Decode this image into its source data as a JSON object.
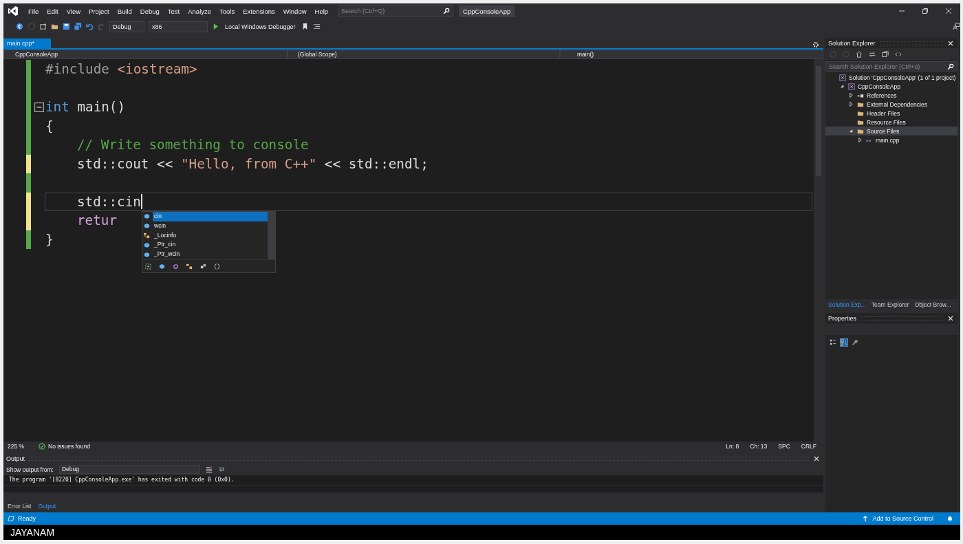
{
  "menu": [
    "File",
    "Edit",
    "View",
    "Project",
    "Build",
    "Debug",
    "Test",
    "Analyze",
    "Tools",
    "Extensions",
    "Window",
    "Help"
  ],
  "search": {
    "placeholder": "Search (Ctrl+Q)"
  },
  "window": {
    "title": "CppConsoleApp"
  },
  "toolbar": {
    "configuration": "Debug",
    "platform": "x86",
    "debugger": "Local Windows Debugger"
  },
  "editor": {
    "tabs": [
      {
        "label": "main.cpp*",
        "selected": true
      }
    ],
    "nav": {
      "project": "CppConsoleApp",
      "scope": "(Global Scope)",
      "member": "main()"
    },
    "lines": [
      {
        "modified": false,
        "fold": false,
        "current": false,
        "indented": false,
        "tokens": [
          {
            "kind": "preproc",
            "text": "#include "
          },
          {
            "kind": "string",
            "text": "<iostream>"
          }
        ]
      },
      {
        "modified": false,
        "fold": false,
        "current": false
      },
      {
        "modified": false,
        "fold": true,
        "current": false,
        "indented": false,
        "tokens": [
          {
            "kind": "keyword",
            "text": "int"
          },
          {
            "kind": "plain",
            "text": " main()"
          }
        ]
      },
      {
        "modified": false,
        "fold": false,
        "current": false,
        "indented": false,
        "tokens": [
          {
            "kind": "plain",
            "text": "{"
          }
        ]
      },
      {
        "modified": false,
        "fold": false,
        "current": false,
        "indented": true,
        "tokens": [
          {
            "kind": "comment",
            "text": "// Write something to console"
          }
        ]
      },
      {
        "modified": true,
        "fold": false,
        "current": false,
        "indented": true,
        "tokens": [
          {
            "kind": "plain",
            "text": "std::cout << "
          },
          {
            "kind": "string",
            "text": "\"Hello, from C++\""
          },
          {
            "kind": "plain",
            "text": " << std::endl;"
          }
        ]
      },
      {
        "modified": false,
        "fold": false,
        "current": false
      },
      {
        "modified": true,
        "fold": false,
        "current": true,
        "indented": true,
        "tokens": [
          {
            "kind": "plain",
            "text": "std::cin"
          }
        ]
      },
      {
        "modified": true,
        "fold": false,
        "current": false,
        "indented": true,
        "tokens": [
          {
            "kind": "control",
            "text": "retur"
          }
        ]
      },
      {
        "modified": false,
        "fold": false,
        "current": false,
        "indented": false,
        "tokens": [
          {
            "kind": "plain",
            "text": "}"
          }
        ]
      }
    ],
    "completion": {
      "items": [
        {
          "label": "cin",
          "kind": "variable",
          "selected": true
        },
        {
          "label": "wcin",
          "kind": "variable",
          "selected": false
        },
        {
          "label": "_Locinfo",
          "kind": "class",
          "selected": false
        },
        {
          "label": "_Ptr_cin",
          "kind": "variable",
          "selected": false
        },
        {
          "label": "_Ptr_wcin",
          "kind": "variable",
          "selected": false
        }
      ]
    },
    "zoom": "225 %",
    "issues": "No issues found",
    "position": {
      "line": "Ln: 8",
      "column": "Ch: 13",
      "indent": "SPC",
      "line_ending": "CRLF"
    }
  },
  "output": {
    "title": "Output",
    "source_label": "Show output from:",
    "source": "Debug",
    "text": "The program '[8220] CppConsoleApp.exe' has exited with code 0 (0x0).",
    "tabs": [
      {
        "label": "Error List",
        "selected": false
      },
      {
        "label": "Output",
        "selected": true
      }
    ]
  },
  "solution_explorer": {
    "title": "Solution Explorer",
    "search": {
      "placeholder": "Search Solution Explorer (Ctrl+ü)"
    },
    "tree": [
      {
        "label": "Solution 'CppConsoleApp' (1 of 1 project)",
        "kind": "solution",
        "selected": false,
        "children": [
          {
            "label": "CppConsoleApp",
            "kind": "project",
            "selected": false,
            "expanded": true,
            "children": [
              {
                "label": "References",
                "kind": "references",
                "selected": false,
                "expanded": false
              },
              {
                "label": "External Dependencies",
                "kind": "dependencies",
                "selected": false,
                "expanded": false
              },
              {
                "label": "Header Files",
                "kind": "folder",
                "selected": false
              },
              {
                "label": "Resource Files",
                "kind": "folder",
                "selected": false
              },
              {
                "label": "Source Files",
                "kind": "source-folder",
                "selected": true,
                "expanded": true,
                "children": [
                  {
                    "label": "main.cpp",
                    "kind": "cpp",
                    "selected": false,
                    "expanded": false
                  }
                ]
              }
            ]
          }
        ]
      }
    ],
    "tabs": [
      {
        "label": "Solution Exp...",
        "selected": true
      },
      {
        "label": "Team Explorer",
        "selected": false
      },
      {
        "label": "Object Brow...",
        "selected": false
      }
    ]
  },
  "properties": {
    "title": "Properties",
    "sort_alphabetical": true
  },
  "status_bar": {
    "state": "Ready",
    "source_control": "Add to Source Control"
  },
  "taskbar": {
    "label": "JAYANAM"
  }
}
